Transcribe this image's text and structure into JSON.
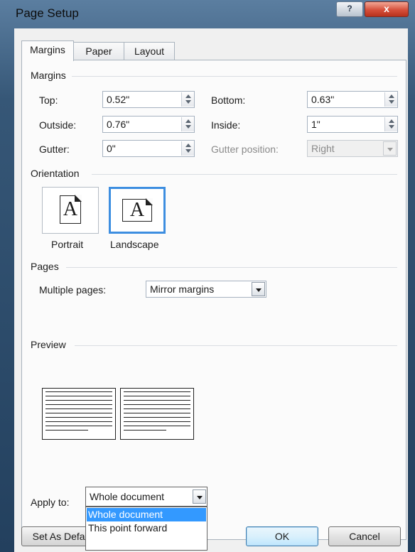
{
  "window": {
    "title": "Page Setup",
    "help_label": "?",
    "close_label": "x"
  },
  "tabs": [
    {
      "label": "Margins",
      "active": true
    },
    {
      "label": "Paper",
      "active": false
    },
    {
      "label": "Layout",
      "active": false
    }
  ],
  "margins": {
    "group_label": "Margins",
    "top": {
      "label": "Top:",
      "value": "0.52\""
    },
    "bottom": {
      "label": "Bottom:",
      "value": "0.63\""
    },
    "outside": {
      "label": "Outside:",
      "value": "0.76\""
    },
    "inside": {
      "label": "Inside:",
      "value": "1\""
    },
    "gutter": {
      "label": "Gutter:",
      "value": "0\""
    },
    "gutter_position": {
      "label": "Gutter position:",
      "value": "Right",
      "enabled": false
    }
  },
  "orientation": {
    "group_label": "Orientation",
    "icon_letter": "A",
    "portrait_label": "Portrait",
    "landscape_label": "Landscape",
    "selected": "Landscape"
  },
  "pages": {
    "group_label": "Pages",
    "multiple_label": "Multiple pages:",
    "multiple_value": "Mirror margins"
  },
  "preview": {
    "group_label": "Preview"
  },
  "apply_to": {
    "label": "Apply to:",
    "value": "Whole document",
    "options": [
      "Whole document",
      "This point forward"
    ],
    "highlighted": "Whole document"
  },
  "buttons": {
    "set_default": "Set As Default",
    "ok": "OK",
    "cancel": "Cancel"
  },
  "colors": {
    "selection": "#3399ff",
    "title_bg": "#365777",
    "close_button": "#d6503b",
    "dialog_bg": "#f0f0f0"
  }
}
